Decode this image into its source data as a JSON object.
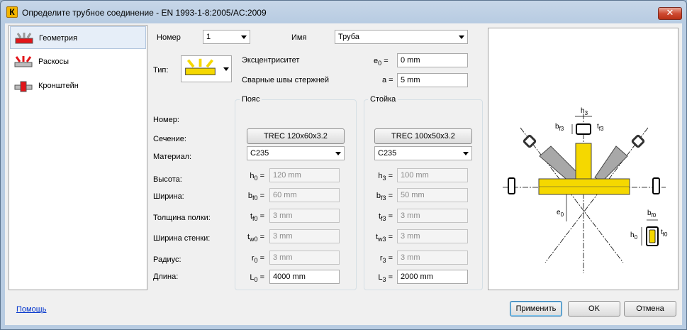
{
  "window": {
    "title": "Определите трубное соединение - EN 1993-1-8:2005/AC:2009",
    "app_icon": "К",
    "close_glyph": "✕"
  },
  "sidebar": {
    "items": [
      {
        "label": "Геометрия",
        "icon": "geometry-icon",
        "active": true
      },
      {
        "label": "Раскосы",
        "icon": "braces-icon",
        "active": false
      },
      {
        "label": "Кронштейн",
        "icon": "bracket-icon",
        "active": false
      }
    ]
  },
  "top": {
    "number_label": "Номер",
    "number_value": "1",
    "name_label": "Имя",
    "name_value": "Труба",
    "type_label": "Тип:",
    "eccentricity_label": "Эксцентриситет",
    "eccentricity_sym": "e",
    "eccentricity_sub": "0",
    "eccentricity_value": "0 mm",
    "welds_label": "Сварные швы стержней",
    "welds_sym": "a",
    "welds_value": "5 mm"
  },
  "row_labels": {
    "number": "Номер:",
    "section": "Сечение:",
    "material": "Материал:",
    "height": "Высота:",
    "width": "Ширина:",
    "flange": "Толщина полки:",
    "web": "Ширина стенки:",
    "radius": "Радиус:",
    "length": "Длина:"
  },
  "chord": {
    "title": "Пояс",
    "section": "TREC 120x60x3.2",
    "material": "C235",
    "fields": [
      {
        "sym": "h",
        "sub": "0",
        "value": "120 mm",
        "disabled": true
      },
      {
        "sym": "b",
        "sub": "f0",
        "value": "60 mm",
        "disabled": true
      },
      {
        "sym": "t",
        "sub": "f0",
        "value": "3 mm",
        "disabled": true
      },
      {
        "sym": "t",
        "sub": "w0",
        "value": "3 mm",
        "disabled": true
      },
      {
        "sym": "r",
        "sub": "0",
        "value": "3 mm",
        "disabled": true
      },
      {
        "sym": "L",
        "sub": "0",
        "value": "4000 mm",
        "disabled": false
      }
    ]
  },
  "post": {
    "title": "Стойка",
    "section": "TREC 100x50x3.2",
    "material": "C235",
    "fields": [
      {
        "sym": "h",
        "sub": "3",
        "value": "100 mm",
        "disabled": true
      },
      {
        "sym": "b",
        "sub": "f3",
        "value": "50 mm",
        "disabled": true
      },
      {
        "sym": "t",
        "sub": "f3",
        "value": "3 mm",
        "disabled": true
      },
      {
        "sym": "t",
        "sub": "w3",
        "value": "3 mm",
        "disabled": true
      },
      {
        "sym": "r",
        "sub": "3",
        "value": "3 mm",
        "disabled": true
      },
      {
        "sym": "L",
        "sub": "3",
        "value": "2000 mm",
        "disabled": false
      }
    ]
  },
  "preview": {
    "labels": {
      "h3": "h",
      "h3_sub": "3",
      "bf3": "b",
      "bf3_sub": "f3",
      "tf3": "t",
      "tf3_sub": "f3",
      "e0": "e",
      "e0_sub": "0",
      "bf0": "b",
      "bf0_sub": "f0",
      "h0": "h",
      "h0_sub": "0",
      "tf0": "t",
      "tf0_sub": "f0"
    },
    "colors": {
      "member": "#f5d800",
      "brace": "#a8a8a8",
      "outline": "#000000"
    }
  },
  "footer": {
    "help": "Помощь",
    "apply": "Применить",
    "ok": "OK",
    "cancel": "Отмена"
  }
}
